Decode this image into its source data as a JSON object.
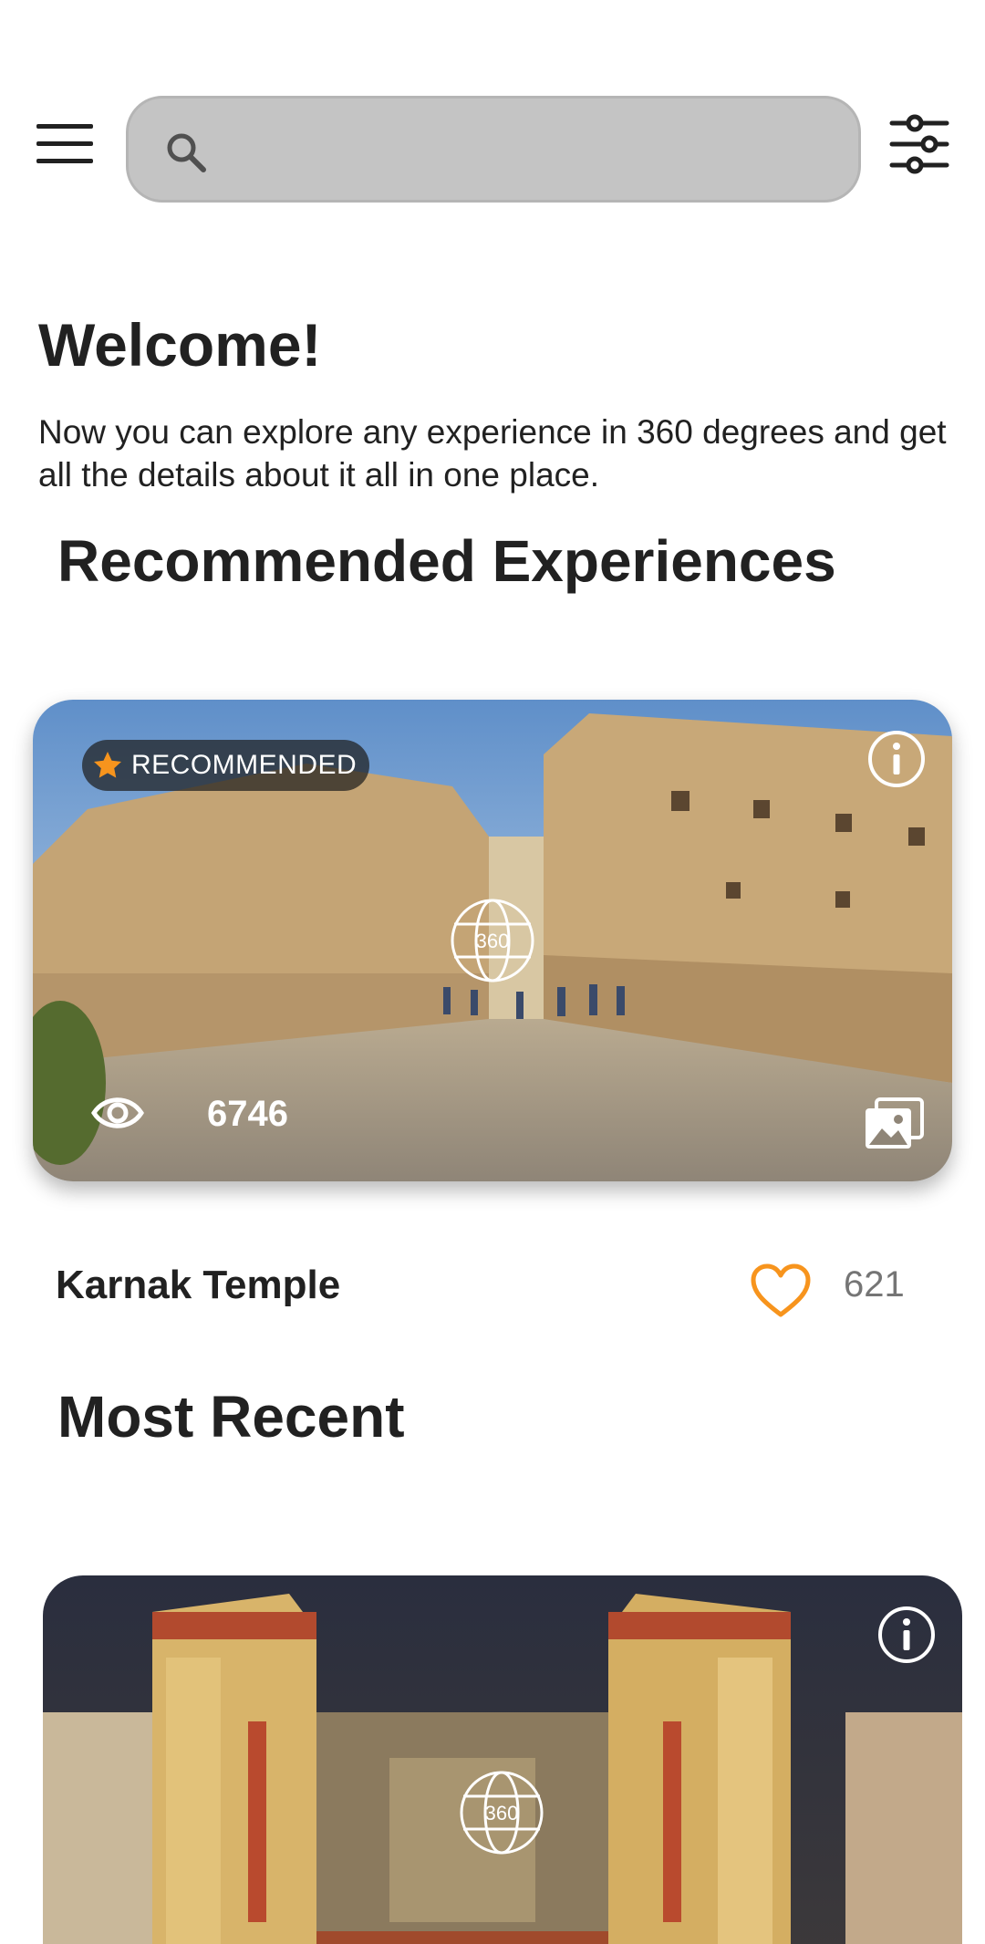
{
  "header": {
    "search_placeholder": "",
    "menu_icon": "hamburger-menu-icon",
    "search_icon": "search-icon",
    "filter_icon": "filter-sliders-icon"
  },
  "welcome": {
    "title": "Welcome!",
    "description": "Now you can explore any experience in 360 degrees and get all the details about it all in one place."
  },
  "recommended": {
    "section_title": "Recommended Experiences",
    "card": {
      "badge_label": "RECOMMENDED",
      "pano_label": "360",
      "views": "6746",
      "name": "Karnak Temple",
      "likes": "621"
    }
  },
  "recent": {
    "section_title": "Most Recent",
    "card": {
      "pano_label": "360"
    }
  },
  "colors": {
    "accent": "#F7941D",
    "search_bg": "#C4C4C4",
    "text": "#212121",
    "muted": "#757575"
  }
}
